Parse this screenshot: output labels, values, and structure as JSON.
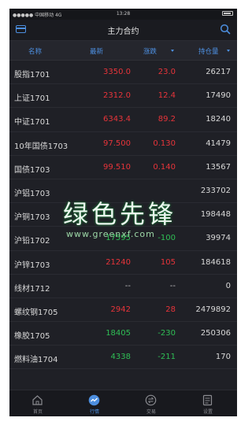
{
  "status_bar": {
    "carrier": "●●●●● 中国移动 4G",
    "time": "13:28"
  },
  "nav": {
    "title": "主力合约"
  },
  "columns": {
    "name": "名称",
    "last": "最新",
    "change": "涨跌",
    "open_interest": "持仓量"
  },
  "rows": [
    {
      "name": "股指1701",
      "last": "3350.0",
      "change": "23.0",
      "oi": "26217",
      "dir": "up"
    },
    {
      "name": "上证1701",
      "last": "2312.0",
      "change": "12.4",
      "oi": "17490",
      "dir": "up"
    },
    {
      "name": "中证1701",
      "last": "6343.4",
      "change": "89.2",
      "oi": "18240",
      "dir": "up"
    },
    {
      "name": "10年国债1703",
      "last": "97.500",
      "change": "0.130",
      "oi": "41479",
      "dir": "up"
    },
    {
      "name": "国债1703",
      "last": "99.510",
      "change": "0.140",
      "oi": "13567",
      "dir": "up"
    },
    {
      "name": "沪铝1703",
      "last": "",
      "change": "",
      "oi": "233702",
      "dir": "down"
    },
    {
      "name": "沪铜1703",
      "last": "",
      "change": "",
      "oi": "198448",
      "dir": "down"
    },
    {
      "name": "沪铅1702",
      "last": "17595",
      "change": "-100",
      "oi": "39974",
      "dir": "down"
    },
    {
      "name": "沪锌1703",
      "last": "21240",
      "change": "105",
      "oi": "184618",
      "dir": "up"
    },
    {
      "name": "线材1712",
      "last": "--",
      "change": "--",
      "oi": "0",
      "dir": "flat"
    },
    {
      "name": "螺纹钢1705",
      "last": "2942",
      "change": "28",
      "oi": "2479892",
      "dir": "up"
    },
    {
      "name": "橡胶1705",
      "last": "18405",
      "change": "-230",
      "oi": "250306",
      "dir": "down"
    },
    {
      "name": "燃料油1704",
      "last": "4338",
      "change": "-211",
      "oi": "170",
      "dir": "down"
    }
  ],
  "tabs": [
    {
      "label": "首页",
      "icon": "home-icon"
    },
    {
      "label": "行情",
      "icon": "market-icon"
    },
    {
      "label": "交易",
      "icon": "trade-icon"
    },
    {
      "label": "设置",
      "icon": "settings-icon"
    }
  ],
  "active_tab": "行情",
  "watermark": {
    "text": "绿色先锋",
    "url": "www.greenxf.com"
  },
  "colors": {
    "accent": "#4d8fe0",
    "up": "#e8343a",
    "down": "#2fbf55"
  }
}
